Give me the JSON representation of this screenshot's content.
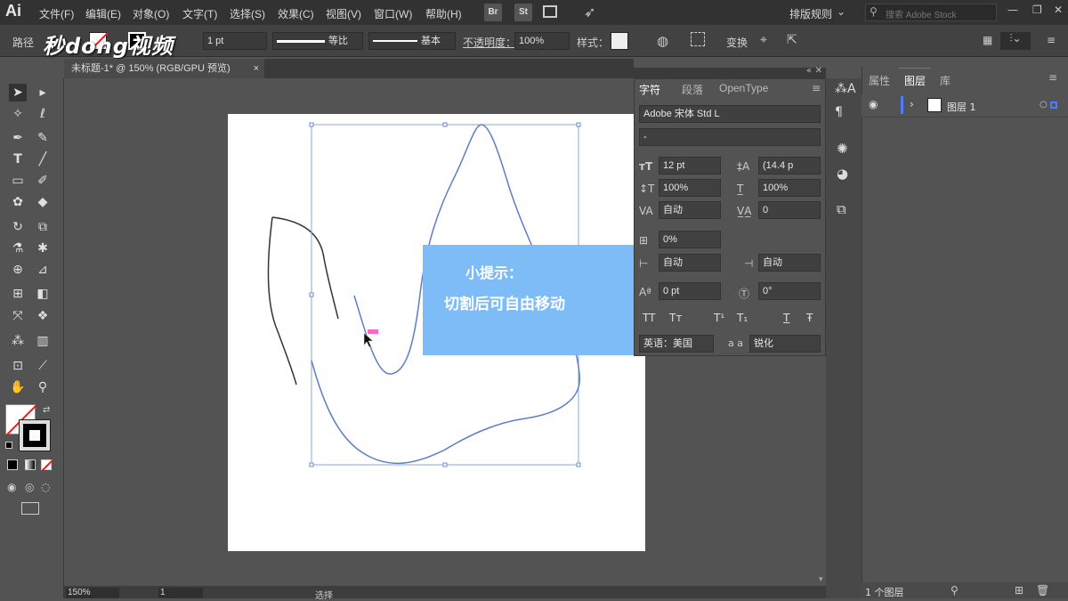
{
  "app": {
    "logo": "Ai",
    "menus": [
      "文件(F)",
      "编辑(E)",
      "对象(O)",
      "文字(T)",
      "选择(S)",
      "效果(C)",
      "视图(V)",
      "窗口(W)",
      "帮助(H)"
    ],
    "bridge": "Br",
    "stock": "St",
    "workspace": "排版规则",
    "search_placeholder": "搜索 Adobe Stock"
  },
  "controlbar": {
    "path_label": "路径",
    "stroke_width": "1 pt",
    "profile": "等比",
    "brush": "基本",
    "opacity_label": "不透明度：",
    "opacity": "100%",
    "style_label": "样式：",
    "transform": "变换"
  },
  "watermark": "秒dong视频",
  "document": {
    "tab_title": "未标题-1* @ 150% (RGB/GPU 预览)",
    "close": "×"
  },
  "character": {
    "tabs": [
      "字符",
      "段落",
      "OpenType"
    ],
    "font": "Adobe 宋体 Std L",
    "style": "-",
    "size": "12 pt",
    "leading": "(14.4 p",
    "vscale": "100%",
    "hscale": "100%",
    "kerning": "自动",
    "tracking": "0",
    "tsume": "0%",
    "aki_left": "自动",
    "aki_right": "自动",
    "baseline": "0 pt",
    "rotation": "0°",
    "lang": "英语：美国",
    "aa_label": "a a",
    "aa": "锐化",
    "textstyles": [
      "TT",
      "Tт",
      "T¹",
      "T₁",
      "T",
      "Ŧ"
    ]
  },
  "layers": {
    "tabs": [
      "属性",
      "图层",
      "库"
    ],
    "layer_name": "图层 1",
    "count": "1 个图层"
  },
  "tip": {
    "title": "小提示：",
    "body": "切割后可自由移动"
  },
  "status": {
    "zoom": "150%",
    "artboard": "1",
    "tool": "选择"
  },
  "colors": {
    "accent": "#7ebcf7",
    "path": "#5b7fc4"
  }
}
